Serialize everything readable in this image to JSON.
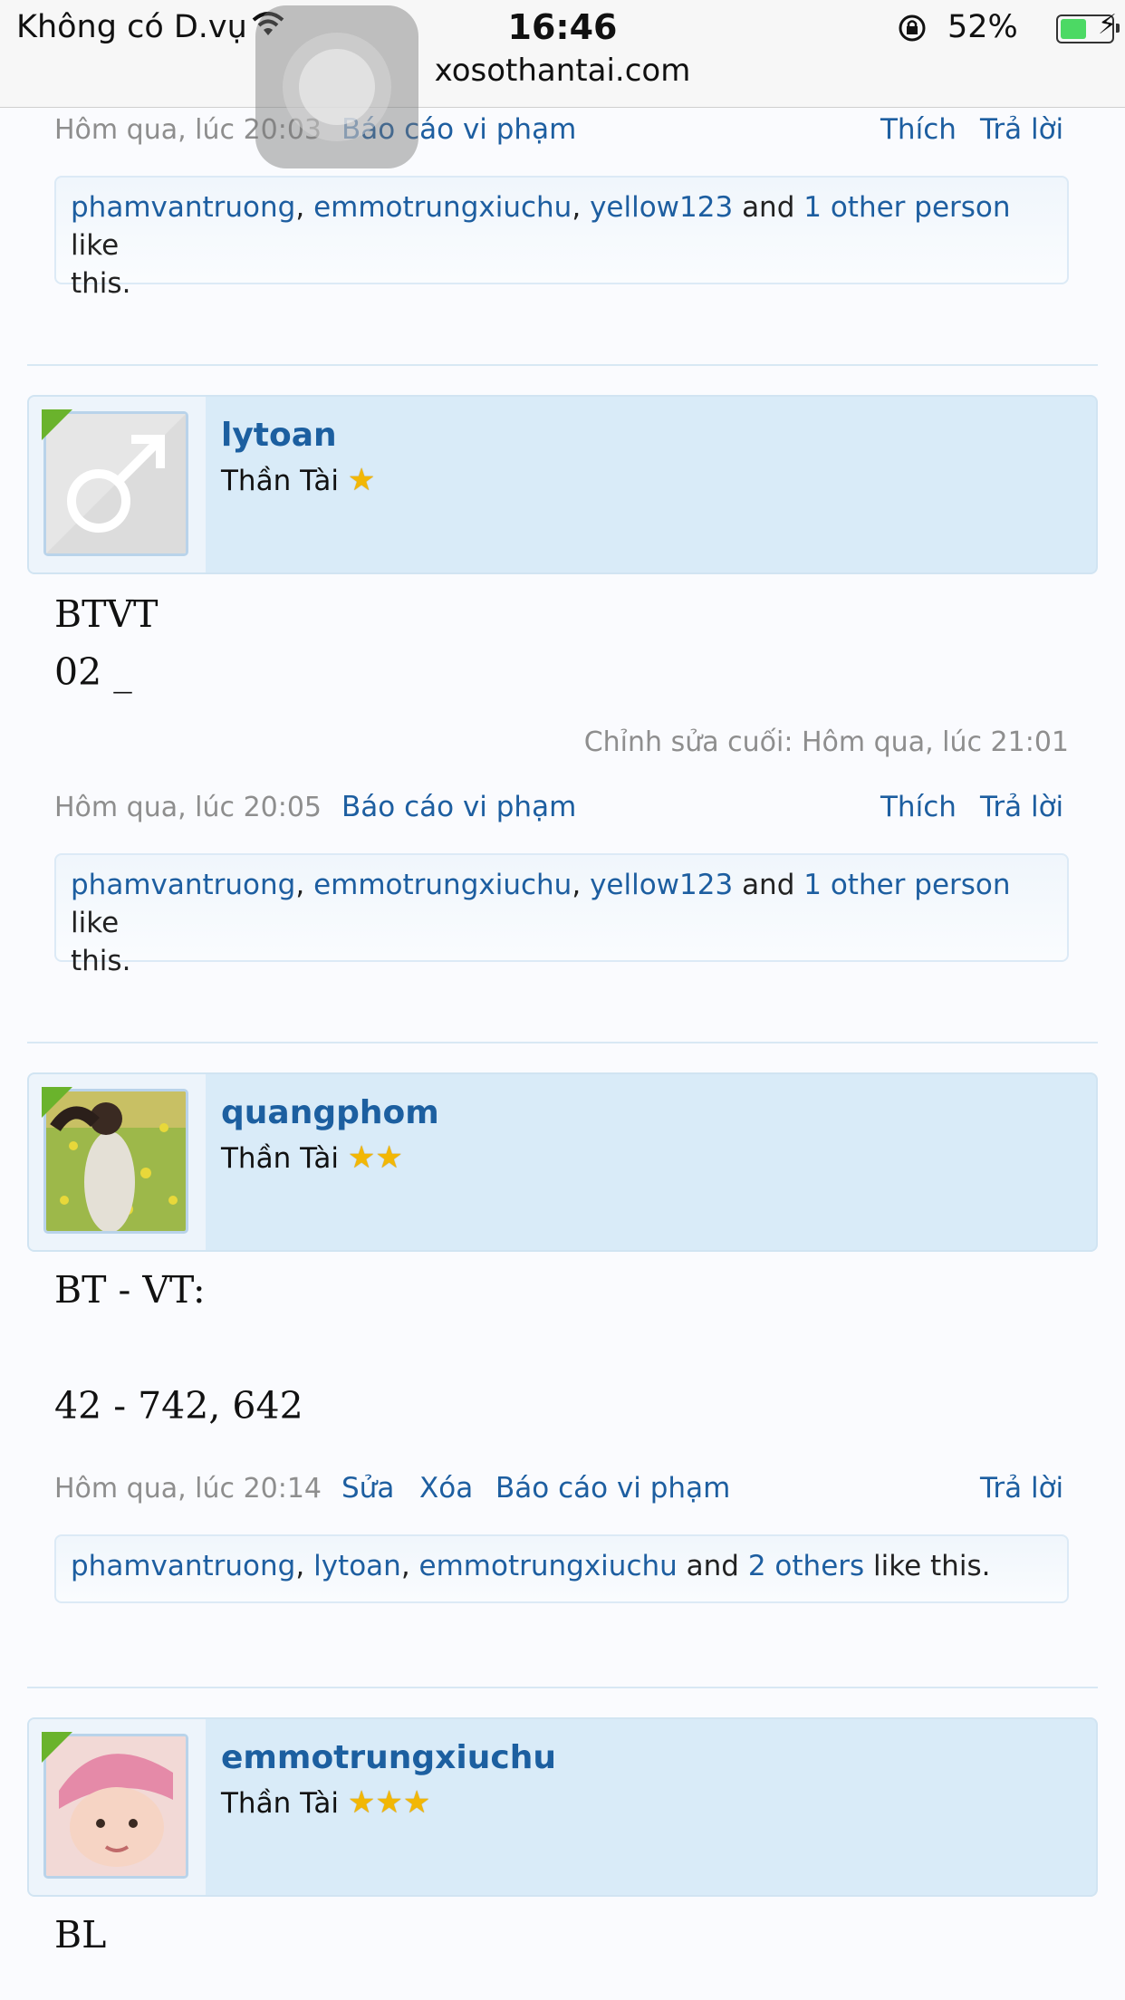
{
  "status_bar": {
    "carrier": "Không có D.vụ",
    "time": "16:46",
    "url": "xosothantai.com",
    "battery": "52%",
    "battery_level": 0.52
  },
  "top_post_tail": {
    "time": "Hôm qua, lúc 20:03",
    "report": "Báo cáo vi phạm",
    "like": "Thích",
    "reply": "Trả lời",
    "likers": [
      "phamvantruong",
      "emmotrungxiuchu",
      "yellow123"
    ],
    "and": "and",
    "others": "1 other person",
    "suffix": "like",
    "suffix2": "this."
  },
  "posts": [
    {
      "username": "lytoan",
      "rank": "Thần Tài",
      "stars": "★",
      "line1": "BTVT",
      "line2": "02 _",
      "edited": "Chỉnh sửa cuối: Hôm qua, lúc 21:01",
      "time": "Hôm qua, lúc 20:05",
      "report": "Báo cáo vi phạm",
      "like": "Thích",
      "reply": "Trả lời",
      "likers": [
        "phamvantruong",
        "emmotrungxiuchu",
        "yellow123"
      ],
      "and": "and",
      "others": "1 other person",
      "suffix": "like",
      "suffix2": "this."
    },
    {
      "username": "quangphom",
      "rank": "Thần Tài",
      "stars": "★★",
      "line1": "BT - VT:",
      "line2": "42 - 742, 642",
      "time": "Hôm qua, lúc 20:14",
      "edit": "Sửa",
      "delete": "Xóa",
      "report": "Báo cáo vi phạm",
      "reply": "Trả lời",
      "likers": [
        "phamvantruong",
        "lytoan",
        "emmotrungxiuchu"
      ],
      "and": "and",
      "others": "2 others",
      "suffix": "like this."
    },
    {
      "username": "emmotrungxiuchu",
      "rank": "Thần Tài",
      "stars": "★★★",
      "line1": "BL"
    }
  ]
}
